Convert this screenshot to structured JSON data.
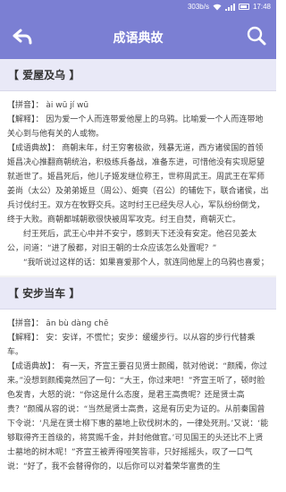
{
  "status": {
    "speed": "303b/s",
    "time": "17:48"
  },
  "header": {
    "title": "成语典故"
  },
  "entries": [
    {
      "title": "【 爱屋及乌 】",
      "pinyin": "【拼音】： ài wū jí wū",
      "meaning": "【解释】： 因为爱一个人而连带爱他屋上的乌鸦。比喻爱一个人而连带地关心到与他有关的人或物。",
      "story": [
        "【成语典故】： 商朝末年，纣王穷奢极欲，残暴无道，西方诸侯国的首领姬昌决心推翻商朝统治，积极练兵备战，准备东进，可惜他没有实现愿望就逝世了。姬昌死后，他儿子姬发继位称王，世称周武王。周武王在军师姜尚（太公）及弟弟姬旦（周公）、姬奭（召公）的辅佐下，联合诸侯，出兵讨伐纣王。双方在牧野交兵。这时纣王已经失尽人心，军队纷纷倒戈，终于大败。商朝都城朝歌很快被周军攻克。纣王自焚，商朝灭亡。",
        "纣王死后，武王心中并不安宁，感到天下还没有安定。他召见姜太公，问道：“进了殷都，对旧王朝的士众应该怎么处置呢？”",
        "“我听说过这样的话：如果喜爱那个人，就连同他屋上的乌鸦也喜爱；"
      ]
    },
    {
      "title": "【 安步当车 】",
      "pinyin": "【拼音】： ān bù dàng chē",
      "meaning": "【解释】： 安：安详，不慌忙；安步：缓缓步行。以从容的步行代替乘车。",
      "story": [
        "【成语典故】： 有一天，齐宣王要召见贤士颜斶，就对他说：“颜斶，你过来。”没想到颜斶竟然回了一句：“大王，你过来吧！”齐宣王听了，顿时脸色发青，大怒的说：“你这是什么态度，是君王高贵呢？还是贤士高贵？”颜斶从容的说：“当然是贤士高贵，这是有历史为证的。从前秦国曾下令说：‘凡是在贤士柳下惠的墓地上砍伐树木的，一律处死刑。’又说：‘能够取得齐王首级的，将赏赐千金，并封他做官。’可见国王的头还比不上贤士墓地的树木呢！”齐宣王被弄得哑笑皆非，只好摇摇头，叹了一口气说：“好了，我不会替得你的，以后你可以对着荣华富贵的生"
      ]
    }
  ]
}
